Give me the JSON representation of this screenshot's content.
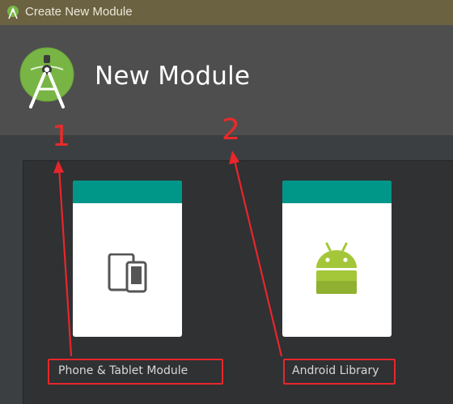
{
  "window": {
    "title": "Create New Module"
  },
  "header": {
    "title": "New Module"
  },
  "modules": [
    {
      "label": "Phone & Tablet Module",
      "icon": "phone-tablet-icon"
    },
    {
      "label": "Android Library",
      "icon": "android-robot-icon"
    }
  ],
  "annotations": [
    {
      "number": "1"
    },
    {
      "number": "2"
    }
  ],
  "colors": {
    "titlebar": "#6b6242",
    "header": "#4e4e4e",
    "card_bar": "#009688",
    "annotation": "#e8262b",
    "android_green": "#a4c639"
  }
}
